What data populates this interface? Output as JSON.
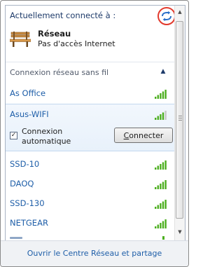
{
  "panel": {
    "connected_header": "Actuellement connecté à :",
    "refresh_icon": "refresh-arrows-icon",
    "connected_network": {
      "name": "Réseau",
      "status": "Pas d'accès Internet",
      "icon": "bench-icon"
    },
    "section_header": "Connexion réseau sans fil",
    "wifi_networks": [
      {
        "name": "As Office",
        "signal_bars": 5
      },
      {
        "name": "Asus-WIFI",
        "signal_bars": 4,
        "selected": true
      },
      {
        "name": "SSD-10",
        "signal_bars": 5
      },
      {
        "name": "DAOQ",
        "signal_bars": 5
      },
      {
        "name": "SSD-130",
        "signal_bars": 5
      },
      {
        "name": "NETGEAR",
        "signal_bars": 5
      }
    ],
    "auto_connect": {
      "label": "Connexion automatique",
      "checked": true,
      "check_glyph": "✓"
    },
    "connect_button": "Connecter",
    "footer_link": "Ouvrir le Centre Réseau et partage"
  },
  "colors": {
    "link": "#1e5ea8",
    "highlight_circle": "#e23a2d",
    "signal_green": "#4caf1f"
  }
}
